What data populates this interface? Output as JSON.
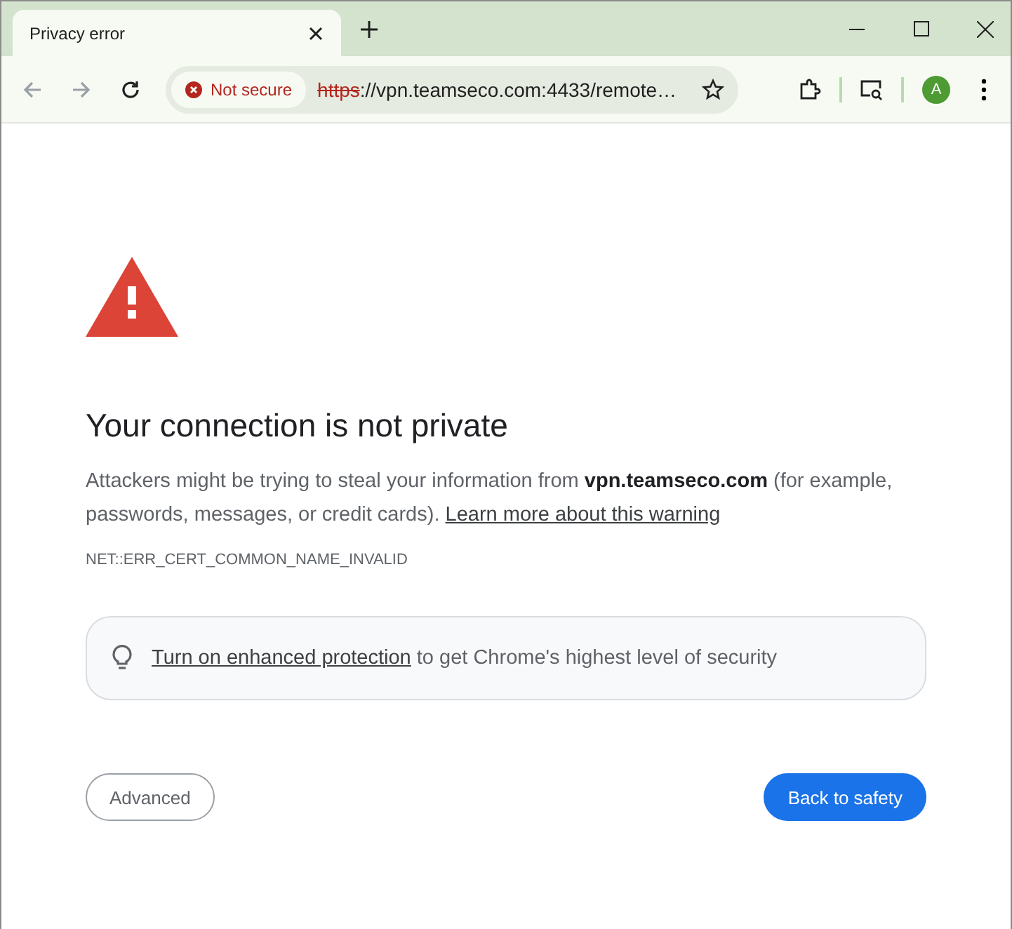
{
  "tab": {
    "title": "Privacy error",
    "selected": true
  },
  "toolbar": {
    "security_chip": "Not secure",
    "url_scheme": "https",
    "url_rest": "://vpn.teamseco.com:4433/remote…",
    "profile_initial": "A"
  },
  "page": {
    "heading": "Your connection is not private",
    "description": "Attackers might be trying to steal your information from **vpn.teamseco.com** (for example, passwords, messages, or credit cards).",
    "learn_more": "Learn more about this warning",
    "error_code": "NET::ERR_CERT_COMMON_NAME_INVALID",
    "protection_link": "Turn on enhanced protection",
    "protection_text": "to get Chrome's highest level of security",
    "buttons": [
      {
        "label": "Advanced",
        "kind": "secondary"
      },
      {
        "label": "Back to safety",
        "kind": "primary"
      }
    ]
  }
}
